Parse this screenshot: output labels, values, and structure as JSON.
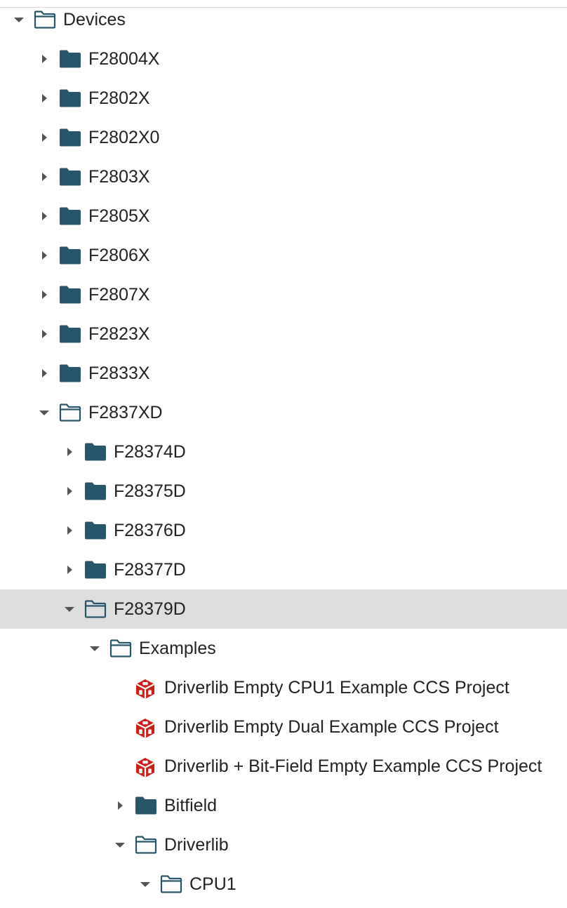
{
  "tree": {
    "items": [
      {
        "label": "Devices",
        "state": "expanded",
        "icon": "folder-open-icon"
      },
      {
        "label": "F28004X",
        "state": "collapsed",
        "icon": "folder-icon"
      },
      {
        "label": "F2802X",
        "state": "collapsed",
        "icon": "folder-icon"
      },
      {
        "label": "F2802X0",
        "state": "collapsed",
        "icon": "folder-icon"
      },
      {
        "label": "F2803X",
        "state": "collapsed",
        "icon": "folder-icon"
      },
      {
        "label": "F2805X",
        "state": "collapsed",
        "icon": "folder-icon"
      },
      {
        "label": "F2806X",
        "state": "collapsed",
        "icon": "folder-icon"
      },
      {
        "label": "F2807X",
        "state": "collapsed",
        "icon": "folder-icon"
      },
      {
        "label": "F2823X",
        "state": "collapsed",
        "icon": "folder-icon"
      },
      {
        "label": "F2833X",
        "state": "collapsed",
        "icon": "folder-icon"
      },
      {
        "label": "F2837XD",
        "state": "expanded",
        "icon": "folder-open-icon"
      },
      {
        "label": "F28374D",
        "state": "collapsed",
        "icon": "folder-icon"
      },
      {
        "label": "F28375D",
        "state": "collapsed",
        "icon": "folder-icon"
      },
      {
        "label": "F28376D",
        "state": "collapsed",
        "icon": "folder-icon"
      },
      {
        "label": "F28377D",
        "state": "collapsed",
        "icon": "folder-icon"
      },
      {
        "label": "F28379D",
        "state": "expanded",
        "selected": true,
        "icon": "folder-open-icon"
      },
      {
        "label": "Examples",
        "state": "expanded",
        "icon": "folder-open-icon"
      },
      {
        "label": "Driverlib Empty CPU1 Example CCS Project",
        "state": "leaf",
        "icon": "project-cube-icon"
      },
      {
        "label": "Driverlib Empty Dual Example CCS Project",
        "state": "leaf",
        "icon": "project-cube-icon"
      },
      {
        "label": "Driverlib + Bit-Field Empty Example CCS Project",
        "state": "leaf",
        "icon": "project-cube-icon"
      },
      {
        "label": "Bitfield",
        "state": "collapsed",
        "icon": "folder-icon"
      },
      {
        "label": "Driverlib",
        "state": "expanded",
        "icon": "folder-open-icon"
      },
      {
        "label": "CPU1",
        "state": "expanded",
        "icon": "folder-open-icon"
      }
    ]
  },
  "colors": {
    "folder": "#27566b",
    "caret": "#555555",
    "project_icon": "#cc1f1a",
    "selected_row": "#dedede",
    "text": "#222222"
  }
}
